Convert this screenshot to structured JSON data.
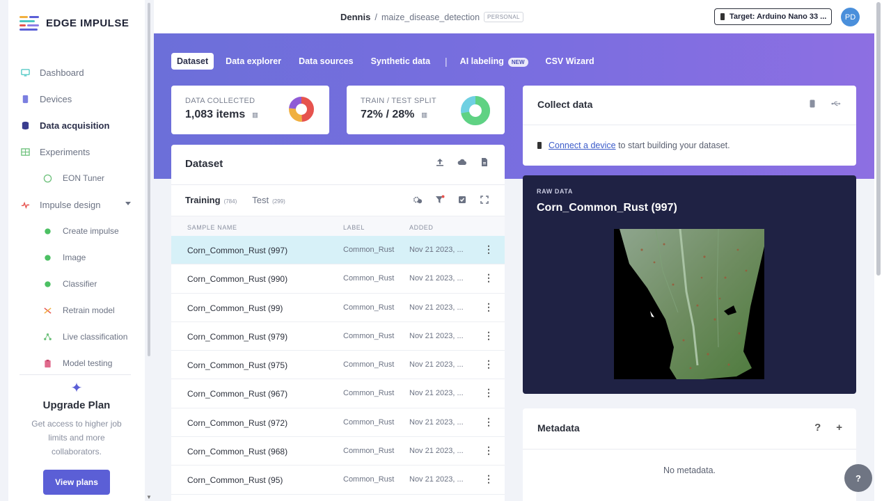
{
  "brand": {
    "name": "EDGE IMPULSE"
  },
  "sidebar": {
    "items": [
      {
        "label": "Dashboard"
      },
      {
        "label": "Devices"
      },
      {
        "label": "Data acquisition"
      },
      {
        "label": "Experiments"
      },
      {
        "label": "EON Tuner"
      },
      {
        "label": "Impulse design"
      },
      {
        "label": "Create impulse"
      },
      {
        "label": "Image"
      },
      {
        "label": "Classifier"
      },
      {
        "label": "Retrain model"
      },
      {
        "label": "Live classification"
      },
      {
        "label": "Model testing"
      }
    ],
    "upgrade": {
      "title": "Upgrade Plan",
      "text": "Get access to higher job limits and more collaborators.",
      "button": "View plans"
    }
  },
  "header": {
    "user": "Dennis",
    "separator": "/",
    "project": "maize_disease_detection",
    "badge": "PERSONAL",
    "target": "Target: Arduino Nano 33 ...",
    "avatar": "PD"
  },
  "tabs": [
    {
      "label": "Dataset"
    },
    {
      "label": "Data explorer"
    },
    {
      "label": "Data sources"
    },
    {
      "label": "Synthetic data"
    },
    {
      "label": "AI labeling"
    },
    {
      "label": "CSV Wizard"
    }
  ],
  "tab_separator": "|",
  "new_badge": "NEW",
  "stats": {
    "collected": {
      "label": "DATA COLLECTED",
      "value": "1,083 items"
    },
    "split": {
      "label": "TRAIN / TEST SPLIT",
      "value": "72% / 28%",
      "train_fraction": 0.72
    }
  },
  "dataset": {
    "title": "Dataset",
    "training": {
      "label": "Training",
      "count": "(784)"
    },
    "test": {
      "label": "Test",
      "count": "(299)"
    },
    "columns": [
      "SAMPLE NAME",
      "LABEL",
      "ADDED"
    ],
    "rows": [
      {
        "name": "Corn_Common_Rust (997)",
        "label": "Common_Rust",
        "added": "Nov 21 2023, ..."
      },
      {
        "name": "Corn_Common_Rust (990)",
        "label": "Common_Rust",
        "added": "Nov 21 2023, ..."
      },
      {
        "name": "Corn_Common_Rust (99)",
        "label": "Common_Rust",
        "added": "Nov 21 2023, ..."
      },
      {
        "name": "Corn_Common_Rust (979)",
        "label": "Common_Rust",
        "added": "Nov 21 2023, ..."
      },
      {
        "name": "Corn_Common_Rust (975)",
        "label": "Common_Rust",
        "added": "Nov 21 2023, ..."
      },
      {
        "name": "Corn_Common_Rust (967)",
        "label": "Common_Rust",
        "added": "Nov 21 2023, ..."
      },
      {
        "name": "Corn_Common_Rust (972)",
        "label": "Common_Rust",
        "added": "Nov 21 2023, ..."
      },
      {
        "name": "Corn_Common_Rust (968)",
        "label": "Common_Rust",
        "added": "Nov 21 2023, ..."
      },
      {
        "name": "Corn_Common_Rust (95)",
        "label": "Common_Rust",
        "added": "Nov 21 2023, ..."
      }
    ]
  },
  "collect": {
    "title": "Collect data",
    "link": "Connect a device",
    "text": "to start building your dataset."
  },
  "raw": {
    "label": "RAW DATA",
    "title": "Corn_Common_Rust (997)"
  },
  "metadata": {
    "title": "Metadata",
    "empty": "No metadata.",
    "help": "?",
    "add": "+"
  },
  "help_button": "?",
  "colors": {
    "accent": "#5b5fd6",
    "band": "#7a6ee0",
    "selected_row": "#d7f1f8",
    "raw_bg": "#1f2244"
  }
}
